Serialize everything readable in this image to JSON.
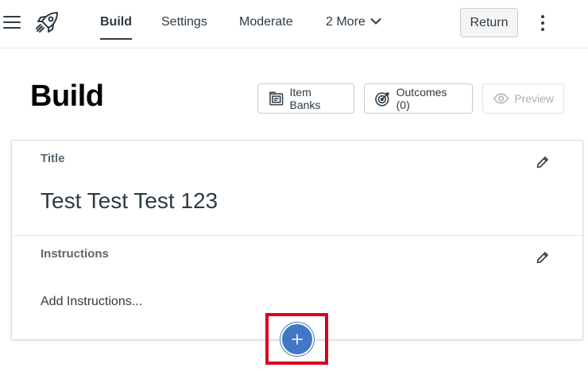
{
  "topnav": {
    "tabs": [
      {
        "label": "Build"
      },
      {
        "label": "Settings"
      },
      {
        "label": "Moderate"
      },
      {
        "label": "2 More"
      }
    ],
    "return_label": "Return"
  },
  "header": {
    "title": "Build",
    "item_banks_label": "Item Banks",
    "outcomes_label": "Outcomes (0)",
    "preview_label": "Preview"
  },
  "card": {
    "title_label": "Title",
    "title_value": "Test Test Test 123",
    "instructions_label": "Instructions",
    "instructions_placeholder": "Add Instructions..."
  },
  "icons": {
    "menu": "hamburger-icon",
    "app": "rocket-icon",
    "more": "kebab-icon",
    "edit": "pencil-icon",
    "add": "plus-icon",
    "item_banks": "folder-icon",
    "outcomes": "target-icon",
    "preview": "eye-icon"
  },
  "colors": {
    "accent": "#4178c6",
    "highlight": "#d9001b",
    "text": "#2d3b45"
  }
}
